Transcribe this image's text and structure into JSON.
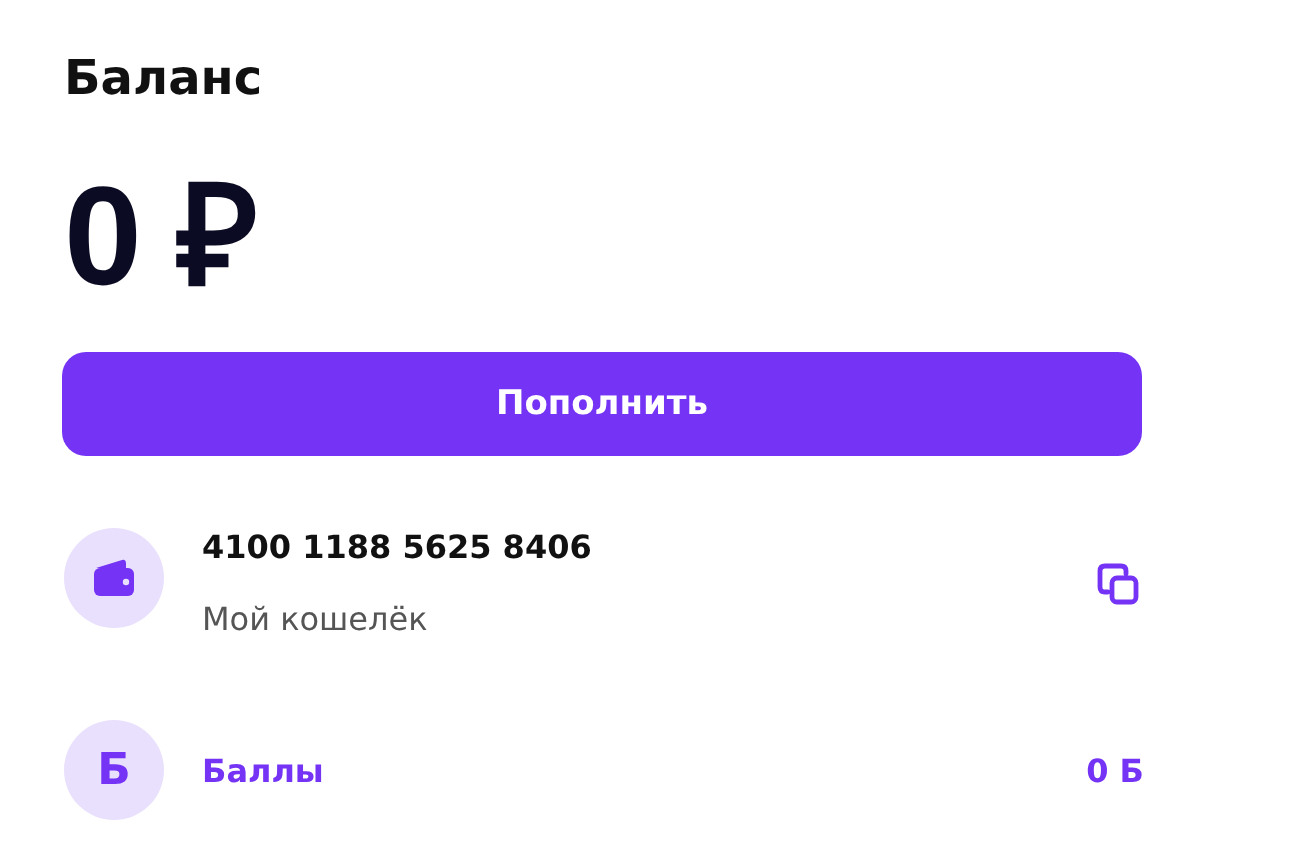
{
  "title": "Баланс",
  "balance": "0 ₽",
  "top_up_button": "Пополнить",
  "accounts": [
    {
      "kind": "wallet",
      "number": "4100 1188 5625 8406",
      "subtitle": "Мой кошелёк",
      "copyable": true
    },
    {
      "kind": "points",
      "icon_char": "Б",
      "label": "Баллы",
      "value": "0 Б"
    }
  ]
}
